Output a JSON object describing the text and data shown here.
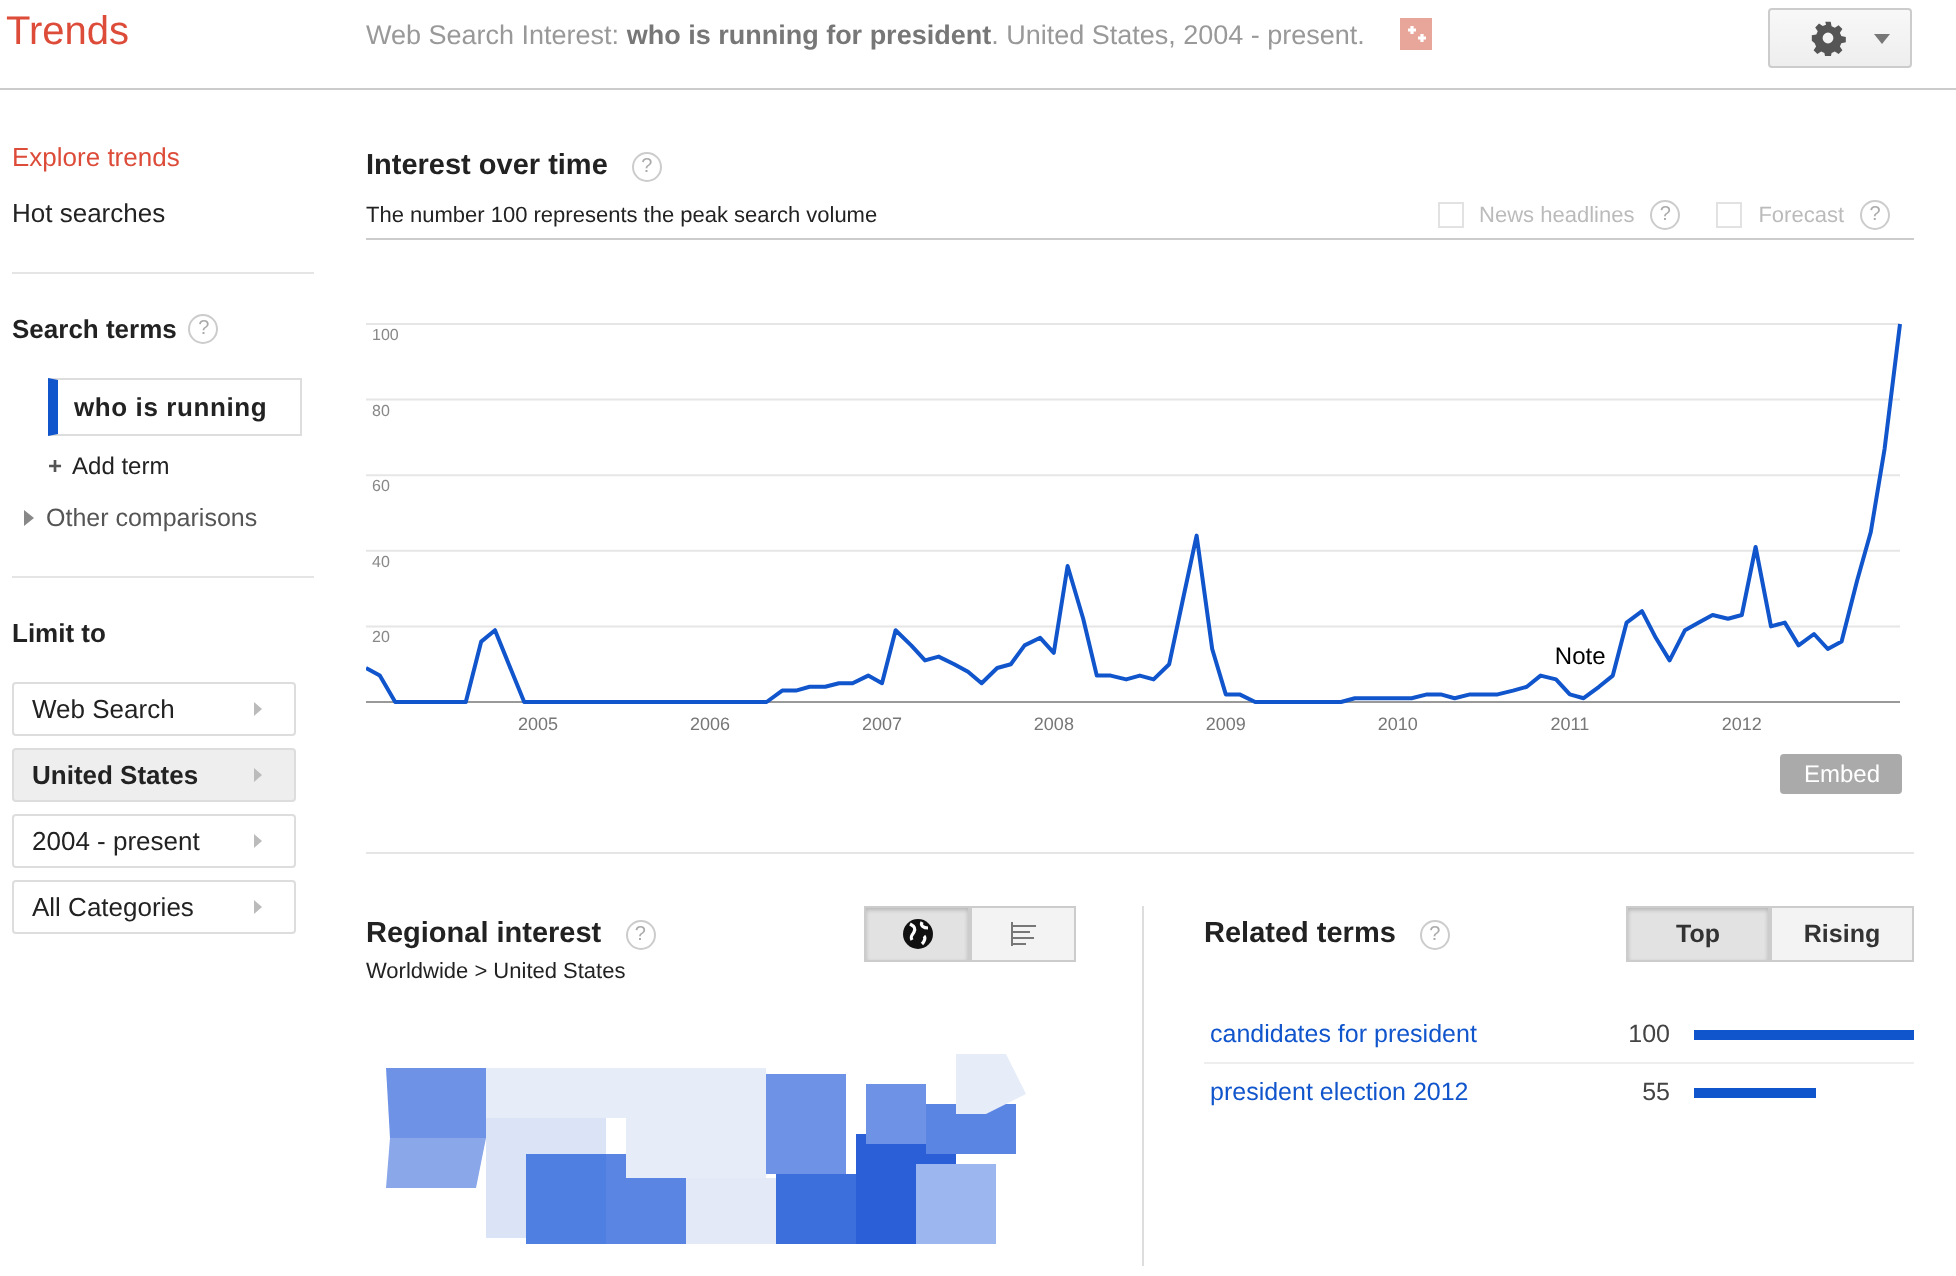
{
  "header": {
    "logo": "Trends",
    "subtitle": "Web Search Interest: **who is running for president**. United States, 2004 - present."
  },
  "sidebar": {
    "nav": [
      {
        "label": "Explore trends",
        "selected": true
      },
      {
        "label": "Hot searches",
        "selected": false
      }
    ],
    "search_terms_title": "Search terms",
    "help": "?",
    "terms": [
      "who is running"
    ],
    "add_term": "Add term",
    "add_icon": "+",
    "other": "Other comparisons",
    "limit_title": "Limit to",
    "limits": [
      {
        "label": "Web Search",
        "selected": false
      },
      {
        "label": "United States",
        "selected": true
      },
      {
        "label": "2004 - present",
        "selected": false
      },
      {
        "label": "All Categories",
        "selected": false
      }
    ]
  },
  "interest": {
    "title": "Interest over time",
    "help": "?",
    "subtitle": "The number 100 represents the peak search volume",
    "options": [
      {
        "label": "News headlines",
        "checked": false,
        "help": "?"
      },
      {
        "label": "Forecast",
        "checked": false,
        "help": "?"
      }
    ],
    "chart_data": {
      "type": "line",
      "grid": true,
      "xlim": [
        2004,
        2012.92
      ],
      "ylim": [
        0,
        100
      ],
      "yticks": [
        20,
        40,
        60,
        80,
        100
      ],
      "xticks": [
        2005,
        2006,
        2007,
        2008,
        2009,
        2010,
        2011,
        2012
      ],
      "x": [
        2004,
        2004.08,
        2004.17,
        2004.25,
        2004.33,
        2004.42,
        2004.5,
        2004.58,
        2004.67,
        2004.75,
        2004.83,
        2004.92,
        2005,
        2005.08,
        2005.17,
        2005.25,
        2005.33,
        2005.42,
        2005.5,
        2005.58,
        2005.67,
        2005.75,
        2005.83,
        2005.92,
        2006,
        2006.08,
        2006.17,
        2006.25,
        2006.33,
        2006.42,
        2006.5,
        2006.58,
        2006.67,
        2006.75,
        2006.83,
        2006.92,
        2007,
        2007.08,
        2007.17,
        2007.25,
        2007.33,
        2007.42,
        2007.5,
        2007.58,
        2007.67,
        2007.75,
        2007.83,
        2007.92,
        2008,
        2008.08,
        2008.17,
        2008.25,
        2008.33,
        2008.42,
        2008.5,
        2008.58,
        2008.67,
        2008.75,
        2008.83,
        2008.92,
        2009,
        2009.08,
        2009.17,
        2009.25,
        2009.33,
        2009.42,
        2009.5,
        2009.58,
        2009.67,
        2009.75,
        2009.83,
        2009.92,
        2010,
        2010.08,
        2010.17,
        2010.25,
        2010.33,
        2010.42,
        2010.5,
        2010.58,
        2010.67,
        2010.75,
        2010.83,
        2010.92,
        2011,
        2011.08,
        2011.17,
        2011.25,
        2011.33,
        2011.42,
        2011.5,
        2011.58,
        2011.67,
        2011.75,
        2011.83,
        2011.92,
        2012,
        2012.08,
        2012.17,
        2012.25,
        2012.33,
        2012.42,
        2012.5,
        2012.58,
        2012.67,
        2012.75,
        2012.83,
        2012.92
      ],
      "series": [
        {
          "color": "#1155cc",
          "values": [
            9,
            7,
            0,
            0,
            0,
            0,
            0,
            0,
            16,
            19,
            10,
            0,
            0,
            0,
            0,
            0,
            0,
            0,
            0,
            0,
            0,
            0,
            0,
            0,
            0,
            0,
            0,
            0,
            0,
            3,
            3,
            4,
            4,
            5,
            5,
            7,
            5,
            19,
            15,
            11,
            12,
            10,
            8,
            5,
            9,
            10,
            15,
            17,
            13,
            36,
            22,
            7,
            7,
            6,
            7,
            6,
            10,
            27,
            44,
            14,
            2,
            2,
            0,
            0,
            0,
            0,
            0,
            0,
            0,
            1,
            1,
            1,
            1,
            1,
            2,
            2,
            1,
            2,
            2,
            2,
            3,
            4,
            7,
            6,
            2,
            1,
            4,
            7,
            21,
            24,
            17,
            11,
            19,
            21,
            23,
            22,
            23,
            41,
            20,
            21,
            15,
            18,
            14,
            16,
            32,
            45,
            67,
            100
          ]
        }
      ],
      "annotations": [
        "Note"
      ]
    },
    "embed": "Embed"
  },
  "regional": {
    "title": "Regional interest",
    "help": "?",
    "views": [
      {
        "kind": "map",
        "selected": true
      },
      {
        "kind": "list",
        "selected": false
      }
    ],
    "breadcrumb": "Worldwide > United States"
  },
  "related": {
    "title": "Related terms",
    "help": "?",
    "tabs": [
      {
        "label": "Top",
        "selected": true
      },
      {
        "label": "Rising",
        "selected": false
      }
    ],
    "rows": [
      {
        "term": "candidates for president",
        "value": "100"
      },
      {
        "term": "president election 2012",
        "value": "55"
      }
    ]
  }
}
